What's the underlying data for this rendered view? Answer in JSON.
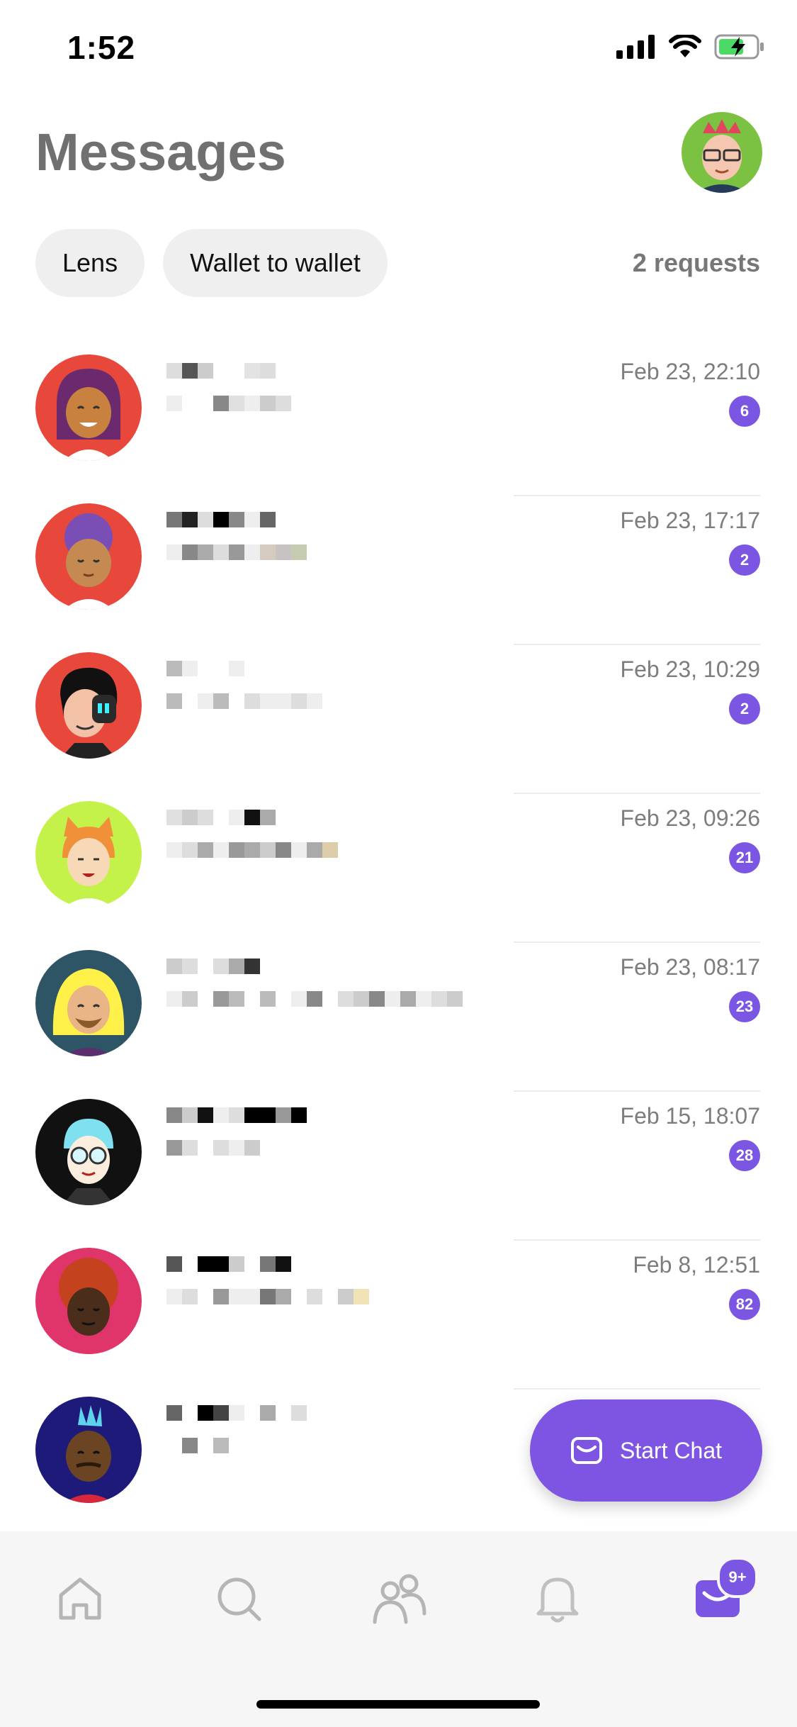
{
  "status_bar": {
    "time": "1:52"
  },
  "header": {
    "title": "Messages"
  },
  "filters": {
    "chips": [
      "Lens",
      "Wallet to wallet"
    ],
    "requests": "2 requests"
  },
  "conversations": [
    {
      "time": "Feb 23, 22:10",
      "unread": "6",
      "avatar": "purple-hair-woman"
    },
    {
      "time": "Feb 23, 17:17",
      "unread": "2",
      "avatar": "curly-purple-hair"
    },
    {
      "time": "Feb 23, 10:29",
      "unread": "2",
      "avatar": "cyborg-eye"
    },
    {
      "time": "Feb 23, 09:26",
      "unread": "21",
      "avatar": "cat-ears"
    },
    {
      "time": "Feb 23, 08:17",
      "unread": "23",
      "avatar": "blonde-beard"
    },
    {
      "time": "Feb 15, 18:07",
      "unread": "28",
      "avatar": "glasses-cyan-hair"
    },
    {
      "time": "Feb 8, 12:51",
      "unread": "82",
      "avatar": "red-curly-hair"
    },
    {
      "time": "",
      "unread": "",
      "avatar": "mohawk-cyan"
    }
  ],
  "fab": {
    "label": "Start Chat"
  },
  "tab_bar": {
    "messages_badge": "9+"
  },
  "colors": {
    "accent": "#7a56e3",
    "title": "#707070",
    "chip_bg": "#efefef"
  }
}
